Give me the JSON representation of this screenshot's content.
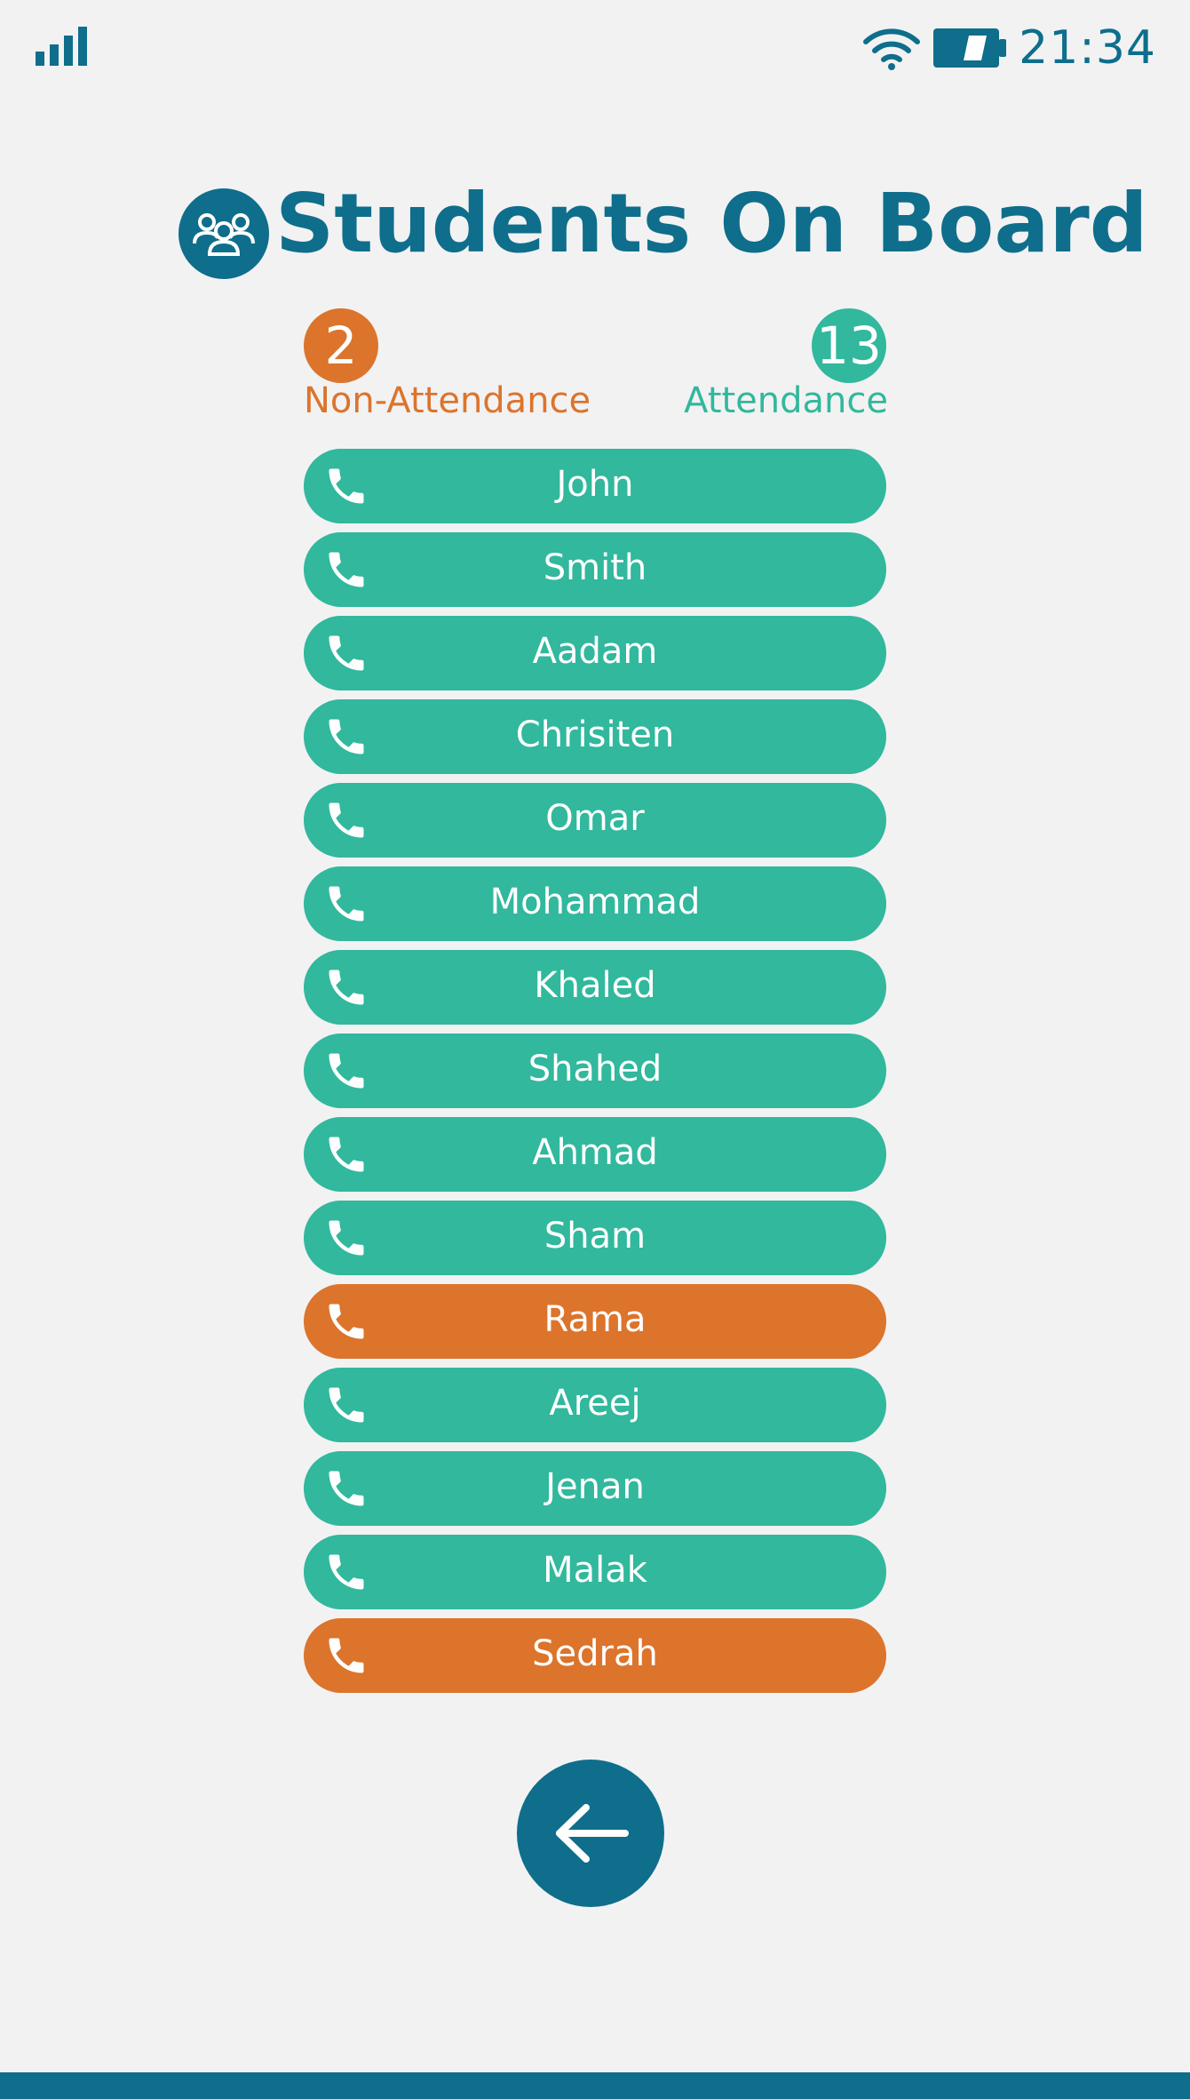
{
  "status_bar": {
    "time": "21:34",
    "icons": [
      "signal-icon",
      "wifi-icon",
      "battery-icon"
    ]
  },
  "header": {
    "title": "Students On Board",
    "icon": "group-icon"
  },
  "counts": {
    "non_attendance": {
      "value": "2",
      "label": "Non-Attendance",
      "color": "#dc742c"
    },
    "attendance": {
      "value": "13",
      "label": "Attendance",
      "color": "#31b89d"
    }
  },
  "students": [
    {
      "name": "John",
      "status": "attendance"
    },
    {
      "name": "Smith",
      "status": "attendance"
    },
    {
      "name": "Aadam",
      "status": "attendance"
    },
    {
      "name": "Chrisiten",
      "status": "attendance"
    },
    {
      "name": "Omar",
      "status": "attendance"
    },
    {
      "name": "Mohammad",
      "status": "attendance"
    },
    {
      "name": "Khaled",
      "status": "attendance"
    },
    {
      "name": "Shahed",
      "status": "attendance"
    },
    {
      "name": "Ahmad",
      "status": "attendance"
    },
    {
      "name": "Sham",
      "status": "attendance"
    },
    {
      "name": "Rama",
      "status": "non-attendance"
    },
    {
      "name": "Areej",
      "status": "attendance"
    },
    {
      "name": "Jenan",
      "status": "attendance"
    },
    {
      "name": "Malak",
      "status": "attendance"
    },
    {
      "name": "Sedrah",
      "status": "non-attendance"
    }
  ],
  "colors": {
    "primary": "#0e6e8c",
    "attendance": "#31b89d",
    "non_attendance": "#dc742c",
    "background": "#f2f2f3"
  },
  "back_button": {
    "icon": "arrow-left-icon"
  }
}
